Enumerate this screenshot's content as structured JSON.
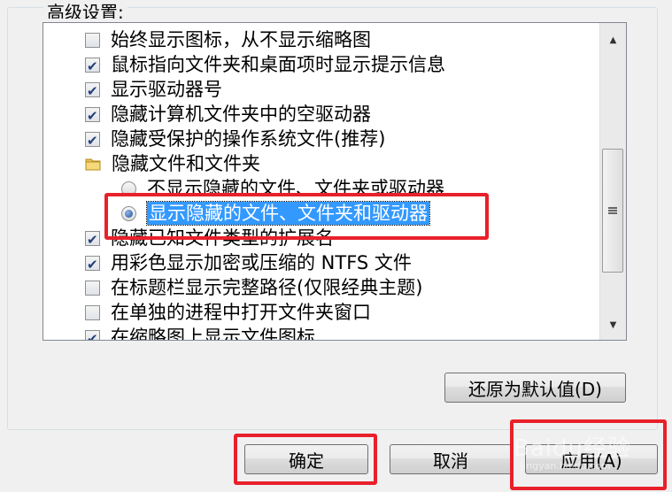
{
  "group": {
    "title": "高级设置:"
  },
  "items": [
    {
      "type": "checkbox",
      "checked": false,
      "label": "始终显示图标，从不显示缩略图"
    },
    {
      "type": "checkbox",
      "checked": true,
      "label": "鼠标指向文件夹和桌面项时显示提示信息"
    },
    {
      "type": "checkbox",
      "checked": true,
      "label": "显示驱动器号"
    },
    {
      "type": "checkbox",
      "checked": true,
      "label": "隐藏计算机文件夹中的空驱动器"
    },
    {
      "type": "checkbox",
      "checked": true,
      "label": "隐藏受保护的操作系统文件(推荐)"
    },
    {
      "type": "folder",
      "label": "隐藏文件和文件夹"
    },
    {
      "type": "radio",
      "selected": false,
      "label": "不显示隐藏的文件、文件夹或驱动器"
    },
    {
      "type": "radio",
      "selected": true,
      "label": "显示隐藏的文件、文件夹和驱动器"
    },
    {
      "type": "checkbox",
      "checked": true,
      "label": "隐藏已知文件类型的扩展名"
    },
    {
      "type": "checkbox",
      "checked": true,
      "label": "用彩色显示加密或压缩的 NTFS 文件"
    },
    {
      "type": "checkbox",
      "checked": false,
      "label": "在标题栏显示完整路径(仅限经典主题)"
    },
    {
      "type": "checkbox",
      "checked": false,
      "label": "在单独的进程中打开文件夹窗口"
    },
    {
      "type": "checkbox",
      "checked": true,
      "label": "在缩略图上显示文件图标"
    }
  ],
  "buttons": {
    "restore_defaults": "还原为默认值(D)",
    "ok": "确定",
    "cancel": "取消",
    "apply": "应用(A)"
  },
  "watermark": {
    "text": "Baidu经验",
    "sub": "jingyan.baidu.com"
  },
  "colors": {
    "highlight": "#3399ff",
    "annotation_red": "#e8202a"
  }
}
